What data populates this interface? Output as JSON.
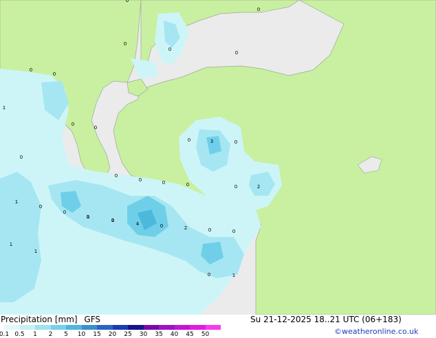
{
  "map": {
    "point_labels": [
      "0",
      "0",
      "0",
      "0",
      "0",
      "0",
      "1",
      "0",
      "0",
      "0",
      "0",
      "0",
      "0",
      "0",
      "0",
      "3",
      "0",
      "0",
      "0",
      "0",
      "0",
      "2",
      "1",
      "0",
      "0",
      "1",
      "1",
      "4",
      "0",
      "2",
      "0",
      "0",
      "1",
      "1",
      "0",
      "1"
    ],
    "colors": {
      "land": "#c8f0a0",
      "sea": "#ebebeb",
      "precip_light": "#cdf5f8",
      "precip_mid": "#a6e6f2",
      "precip_heavy": "#6fcfe8",
      "precip_max": "#4bb8dc"
    }
  },
  "footer": {
    "title": "Precipitation [mm]",
    "model": "GFS",
    "valid_time": "Su 21-12-2025 18..21 UTC (06+183)",
    "credit": "©weatheronline.co.uk"
  },
  "legend": {
    "ticks": [
      "0.1",
      "0.5",
      "1",
      "2",
      "5",
      "10",
      "15",
      "20",
      "25",
      "30",
      "35",
      "40",
      "45",
      "50"
    ],
    "colors": [
      "#e2f8fa",
      "#c6f0f5",
      "#9fe2ef",
      "#76d0e8",
      "#4fb6dd",
      "#3a8fd0",
      "#2a64c4",
      "#1c3cb0",
      "#14148c",
      "#7a0aa8",
      "#9c12c4",
      "#c216d2",
      "#e21ce0",
      "#f43cf0"
    ]
  }
}
